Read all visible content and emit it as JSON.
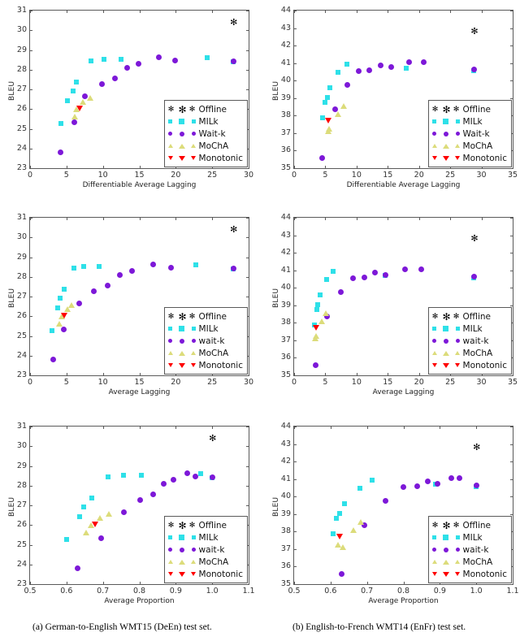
{
  "figure": {
    "captions": [
      "(a) German-to-English WMT15 (DeEn) test set.",
      "(b) English-to-French WMT14 (EnFr) test set."
    ]
  },
  "chart_data": [
    {
      "id": "deen-dal",
      "type": "scatter",
      "title": "",
      "xlabel": "Differentiable Average Lagging",
      "ylabel": "BLEU",
      "xlim": [
        0,
        30
      ],
      "ylim": [
        23,
        31
      ],
      "xticks": [
        0,
        5,
        10,
        15,
        20,
        25,
        30
      ],
      "yticks": [
        23,
        24,
        25,
        26,
        27,
        28,
        29,
        30,
        31
      ],
      "grid": false,
      "legend_position": "lower right",
      "legend": [
        "Offline",
        "MILk",
        "Wait-k",
        "MoChA",
        "Monotonic"
      ],
      "series": [
        {
          "name": "Offline",
          "marker": "star",
          "color": "#000000",
          "points": [
            [
              27.9,
              30.4
            ]
          ]
        },
        {
          "name": "MILk",
          "marker": "square",
          "color": "#2ee0e8",
          "points": [
            [
              4.2,
              25.28
            ],
            [
              5.1,
              26.43
            ],
            [
              5.9,
              26.9
            ],
            [
              6.4,
              27.38
            ],
            [
              8.4,
              28.44
            ],
            [
              10.2,
              28.52
            ],
            [
              12.5,
              28.53
            ],
            [
              24.3,
              28.59
            ],
            [
              27.9,
              28.4
            ]
          ]
        },
        {
          "name": "Wait-k",
          "marker": "circle",
          "color": "#7d18d8",
          "points": [
            [
              4.2,
              23.8
            ],
            [
              6.1,
              25.32
            ],
            [
              7.5,
              26.64
            ],
            [
              9.9,
              27.27
            ],
            [
              11.6,
              27.56
            ],
            [
              13.3,
              28.08
            ],
            [
              14.9,
              28.3
            ],
            [
              17.7,
              28.62
            ],
            [
              19.9,
              28.46
            ],
            [
              27.9,
              28.44
            ]
          ]
        },
        {
          "name": "MoChA",
          "marker": "triangle-up",
          "color": "#dcdc7a",
          "points": [
            [
              6.1,
              25.62
            ],
            [
              6.4,
              26.0
            ],
            [
              7.2,
              26.37
            ],
            [
              8.3,
              26.57
            ]
          ]
        },
        {
          "name": "Monotonic",
          "marker": "triangle-down",
          "color": "#fe0000",
          "points": [
            [
              6.8,
              26.05
            ]
          ]
        }
      ]
    },
    {
      "id": "enfr-dal",
      "type": "scatter",
      "title": "",
      "xlabel": "Differentiable Average Lagging",
      "ylabel": "BLEU",
      "xlim": [
        0,
        35
      ],
      "ylim": [
        35,
        44
      ],
      "xticks": [
        0,
        5,
        10,
        15,
        20,
        25,
        30,
        35
      ],
      "yticks": [
        35,
        36,
        37,
        38,
        39,
        40,
        41,
        42,
        43,
        44
      ],
      "grid": false,
      "legend_position": "lower right",
      "legend": [
        "Offline",
        "MILk",
        "Wait-k",
        "MoChA",
        "Monotonic"
      ],
      "series": [
        {
          "name": "Offline",
          "marker": "star",
          "color": "#000000",
          "points": [
            [
              28.8,
              42.79
            ]
          ]
        },
        {
          "name": "MILk",
          "marker": "square",
          "color": "#2ee0e8",
          "points": [
            [
              4.6,
              37.87
            ],
            [
              4.9,
              38.74
            ],
            [
              5.3,
              39.04
            ],
            [
              5.7,
              39.58
            ],
            [
              7.0,
              40.48
            ],
            [
              8.4,
              40.95
            ],
            [
              17.9,
              40.71
            ],
            [
              28.8,
              40.55
            ]
          ]
        },
        {
          "name": "Wait-k",
          "marker": "circle",
          "color": "#7d18d8",
          "points": [
            [
              4.5,
              35.57
            ],
            [
              6.6,
              38.38
            ],
            [
              8.5,
              39.77
            ],
            [
              10.3,
              40.55
            ],
            [
              12.0,
              40.57
            ],
            [
              13.9,
              40.88
            ],
            [
              15.5,
              40.77
            ],
            [
              18.4,
              41.07
            ],
            [
              20.8,
              41.07
            ],
            [
              28.8,
              40.64
            ]
          ]
        },
        {
          "name": "MoChA",
          "marker": "triangle-up",
          "color": "#dcdc7a",
          "points": [
            [
              5.5,
              37.1
            ],
            [
              5.6,
              37.23
            ],
            [
              7.0,
              38.1
            ],
            [
              8.0,
              38.54
            ]
          ]
        },
        {
          "name": "Monotonic",
          "marker": "triangle-down",
          "color": "#fe0000",
          "points": [
            [
              5.5,
              37.73
            ]
          ]
        }
      ]
    },
    {
      "id": "deen-al",
      "type": "scatter",
      "title": "",
      "xlabel": "Average Lagging",
      "ylabel": "BLEU",
      "xlim": [
        0,
        30
      ],
      "ylim": [
        23,
        31
      ],
      "xticks": [
        0,
        5,
        10,
        15,
        20,
        25,
        30
      ],
      "yticks": [
        23,
        24,
        25,
        26,
        27,
        28,
        29,
        30,
        31
      ],
      "grid": false,
      "legend_position": "lower right",
      "legend": [
        "Offline",
        "MILk",
        "wait-k",
        "MoChA",
        "Monotonic"
      ],
      "series": [
        {
          "name": "Offline",
          "marker": "star",
          "color": "#000000",
          "points": [
            [
              27.9,
              30.4
            ]
          ]
        },
        {
          "name": "MILk",
          "marker": "square",
          "color": "#2ee0e8",
          "points": [
            [
              3.0,
              25.28
            ],
            [
              3.8,
              26.43
            ],
            [
              4.1,
              26.9
            ],
            [
              4.7,
              27.38
            ],
            [
              6.0,
              28.44
            ],
            [
              7.4,
              28.52
            ],
            [
              9.5,
              28.53
            ],
            [
              22.8,
              28.59
            ],
            [
              27.9,
              28.4
            ]
          ]
        },
        {
          "name": "wait-k",
          "marker": "circle",
          "color": "#7d18d8",
          "points": [
            [
              3.2,
              23.8
            ],
            [
              4.6,
              25.32
            ],
            [
              6.8,
              26.64
            ],
            [
              8.8,
              27.27
            ],
            [
              10.6,
              27.56
            ],
            [
              12.3,
              28.08
            ],
            [
              14.0,
              28.3
            ],
            [
              16.9,
              28.62
            ],
            [
              19.4,
              28.46
            ],
            [
              27.9,
              28.44
            ]
          ]
        },
        {
          "name": "MoChA",
          "marker": "triangle-up",
          "color": "#dcdc7a",
          "points": [
            [
              4.0,
              25.62
            ],
            [
              4.4,
              26.0
            ],
            [
              5.1,
              26.37
            ],
            [
              5.7,
              26.57
            ]
          ]
        },
        {
          "name": "Monotonic",
          "marker": "triangle-down",
          "color": "#fe0000",
          "points": [
            [
              4.7,
              26.05
            ]
          ]
        }
      ]
    },
    {
      "id": "enfr-al",
      "type": "scatter",
      "title": "",
      "xlabel": "Average Lagging",
      "ylabel": "BLEU",
      "xlim": [
        0,
        35
      ],
      "ylim": [
        35,
        44
      ],
      "xticks": [
        0,
        5,
        10,
        15,
        20,
        25,
        30,
        35
      ],
      "yticks": [
        35,
        36,
        37,
        38,
        39,
        40,
        41,
        42,
        43,
        44
      ],
      "grid": false,
      "legend_position": "lower right",
      "legend": [
        "Offline",
        "MILk",
        "wait-k",
        "MoChA",
        "Monotonic"
      ],
      "series": [
        {
          "name": "Offline",
          "marker": "star",
          "color": "#000000",
          "points": [
            [
              28.8,
              42.79
            ]
          ]
        },
        {
          "name": "MILk",
          "marker": "square",
          "color": "#2ee0e8",
          "points": [
            [
              3.2,
              37.87
            ],
            [
              3.6,
              38.74
            ],
            [
              3.8,
              39.04
            ],
            [
              4.1,
              39.58
            ],
            [
              5.2,
              40.48
            ],
            [
              6.2,
              40.95
            ],
            [
              14.6,
              40.71
            ],
            [
              28.8,
              40.55
            ]
          ]
        },
        {
          "name": "wait-k",
          "marker": "circle",
          "color": "#7d18d8",
          "points": [
            [
              3.5,
              35.57
            ],
            [
              5.3,
              38.38
            ],
            [
              7.5,
              39.77
            ],
            [
              9.4,
              40.55
            ],
            [
              11.3,
              40.57
            ],
            [
              13.0,
              40.88
            ],
            [
              14.7,
              40.73
            ],
            [
              17.8,
              41.07
            ],
            [
              20.3,
              41.07
            ],
            [
              28.8,
              40.64
            ]
          ]
        },
        {
          "name": "MoChA",
          "marker": "triangle-up",
          "color": "#dcdc7a",
          "points": [
            [
              3.4,
              37.1
            ],
            [
              3.5,
              37.23
            ],
            [
              4.4,
              38.1
            ],
            [
              5.1,
              38.54
            ]
          ]
        },
        {
          "name": "Monotonic",
          "marker": "triangle-down",
          "color": "#fe0000",
          "points": [
            [
              3.5,
              37.73
            ]
          ]
        }
      ]
    },
    {
      "id": "deen-ap",
      "type": "scatter",
      "title": "",
      "xlabel": "Average Proportion",
      "ylabel": "BLEU",
      "xlim": [
        0.5,
        1.1
      ],
      "ylim": [
        23,
        31
      ],
      "xticks": [
        0.5,
        0.6,
        0.7,
        0.8,
        0.9,
        1.0,
        1.1
      ],
      "xticklabels": [
        "0.5",
        "0.6",
        "0.7",
        "0.8",
        "0.9",
        "1.0",
        "1.1"
      ],
      "yticks": [
        23,
        24,
        25,
        26,
        27,
        28,
        29,
        30,
        31
      ],
      "grid": false,
      "legend_position": "lower right",
      "legend": [
        "Offline",
        "MILk",
        "wait-k",
        "MoChA",
        "Monotonic"
      ],
      "series": [
        {
          "name": "Offline",
          "marker": "star",
          "color": "#000000",
          "points": [
            [
              1.0,
              30.4
            ]
          ]
        },
        {
          "name": "MILk",
          "marker": "square",
          "color": "#2ee0e8",
          "points": [
            [
              0.6,
              25.28
            ],
            [
              0.635,
              26.43
            ],
            [
              0.648,
              26.9
            ],
            [
              0.669,
              27.38
            ],
            [
              0.714,
              28.44
            ],
            [
              0.757,
              28.52
            ],
            [
              0.806,
              28.53
            ],
            [
              0.969,
              28.59
            ],
            [
              1.0,
              28.4
            ]
          ]
        },
        {
          "name": "wait-k",
          "marker": "circle",
          "color": "#7d18d8",
          "points": [
            [
              0.63,
              23.8
            ],
            [
              0.695,
              25.32
            ],
            [
              0.757,
              26.64
            ],
            [
              0.803,
              27.27
            ],
            [
              0.838,
              27.56
            ],
            [
              0.868,
              28.08
            ],
            [
              0.894,
              28.3
            ],
            [
              0.932,
              28.62
            ],
            [
              0.955,
              28.46
            ],
            [
              1.0,
              28.44
            ]
          ]
        },
        {
          "name": "MoChA",
          "marker": "triangle-up",
          "color": "#dcdc7a",
          "points": [
            [
              0.655,
              25.62
            ],
            [
              0.668,
              26.0
            ],
            [
              0.692,
              26.37
            ],
            [
              0.717,
              26.57
            ]
          ]
        },
        {
          "name": "Monotonic",
          "marker": "triangle-down",
          "color": "#fe0000",
          "points": [
            [
              0.679,
              26.05
            ]
          ]
        }
      ]
    },
    {
      "id": "enfr-ap",
      "type": "scatter",
      "title": "",
      "xlabel": "Average Proportion",
      "ylabel": "BLEU",
      "xlim": [
        0.5,
        1.1
      ],
      "ylim": [
        35,
        44
      ],
      "xticks": [
        0.5,
        0.6,
        0.7,
        0.8,
        0.9,
        1.0,
        1.1
      ],
      "xticklabels": [
        "0.5",
        "0.6",
        "0.7",
        "0.8",
        "0.9",
        "1.0",
        "1.1"
      ],
      "yticks": [
        35,
        36,
        37,
        38,
        39,
        40,
        41,
        42,
        43,
        44
      ],
      "grid": false,
      "legend_position": "lower right",
      "legend": [
        "Offline",
        "MILk",
        "wait-k",
        "MoChA",
        "Monotonic"
      ],
      "series": [
        {
          "name": "Offline",
          "marker": "star",
          "color": "#000000",
          "points": [
            [
              1.0,
              42.79
            ]
          ]
        },
        {
          "name": "MILk",
          "marker": "square",
          "color": "#2ee0e8",
          "points": [
            [
              0.607,
              37.87
            ],
            [
              0.617,
              38.74
            ],
            [
              0.624,
              39.04
            ],
            [
              0.638,
              39.58
            ],
            [
              0.681,
              40.48
            ],
            [
              0.714,
              40.95
            ],
            [
              0.888,
              40.71
            ],
            [
              1.0,
              40.55
            ]
          ]
        },
        {
          "name": "wait-k",
          "marker": "circle",
          "color": "#7d18d8",
          "points": [
            [
              0.631,
              35.57
            ],
            [
              0.693,
              38.38
            ],
            [
              0.752,
              39.77
            ],
            [
              0.799,
              40.55
            ],
            [
              0.838,
              40.57
            ],
            [
              0.867,
              40.88
            ],
            [
              0.894,
              40.73
            ],
            [
              0.931,
              41.07
            ],
            [
              0.955,
              41.07
            ],
            [
              1.0,
              40.62
            ]
          ]
        },
        {
          "name": "MoChA",
          "marker": "triangle-up",
          "color": "#dcdc7a",
          "points": [
            [
              0.621,
              37.23
            ],
            [
              0.634,
              37.1
            ],
            [
              0.663,
              38.07
            ],
            [
              0.684,
              38.55
            ]
          ]
        },
        {
          "name": "Monotonic",
          "marker": "triangle-down",
          "color": "#fe0000",
          "points": [
            [
              0.625,
              37.73
            ]
          ]
        }
      ]
    }
  ]
}
